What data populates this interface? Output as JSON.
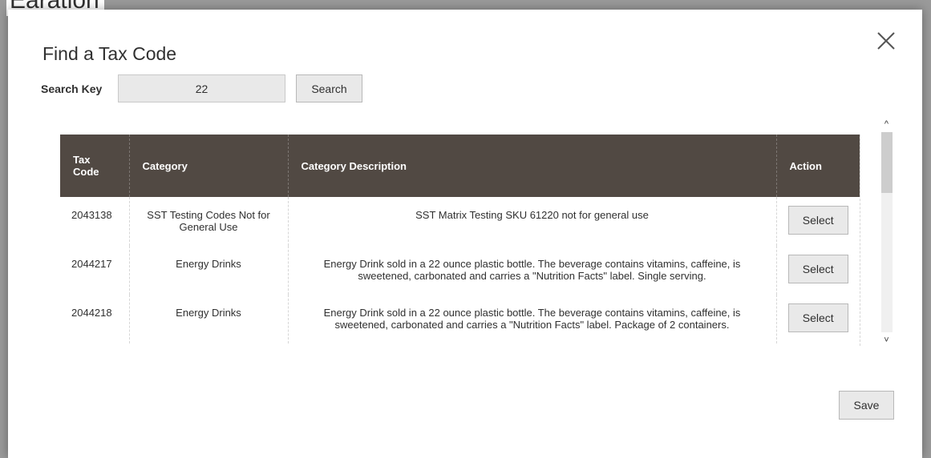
{
  "background": {
    "title_fragment": "Earation"
  },
  "modal": {
    "title": "Find a Tax Code",
    "close_icon": "close-icon",
    "search": {
      "label": "Search Key",
      "value": "22",
      "button_label": "Search"
    },
    "table": {
      "headers": [
        "Tax\nCode",
        "Category",
        "Category Description",
        "Action"
      ],
      "rows": [
        {
          "tax_code": "2043138",
          "category": "SST Testing Codes Not for General Use",
          "description": "SST Matrix Testing SKU 61220 not for general use",
          "action": "Select"
        },
        {
          "tax_code": "2044217",
          "category": "Energy Drinks",
          "description": "Energy Drink sold in a 22 ounce plastic bottle. The beverage contains vitamins, caffeine, is sweetened, carbonated and carries a \"Nutrition Facts\" label. Single serving.",
          "action": "Select"
        },
        {
          "tax_code": "2044218",
          "category": "Energy Drinks",
          "description": "Energy Drink sold in a 22 ounce plastic bottle. The beverage contains vitamins, caffeine, is sweetened, carbonated and carries a \"Nutrition Facts\" label. Package of 2 containers.",
          "action": "Select"
        }
      ]
    },
    "scrollbar": {
      "up_icon": "chevron-up-icon",
      "down_icon": "chevron-down-icon",
      "up_glyph": "^",
      "down_glyph": "˅"
    },
    "save_label": "Save"
  },
  "colors": {
    "header_bg": "#514943",
    "button_bg": "#e9e9e9",
    "overlay": "#9a9a9a"
  }
}
